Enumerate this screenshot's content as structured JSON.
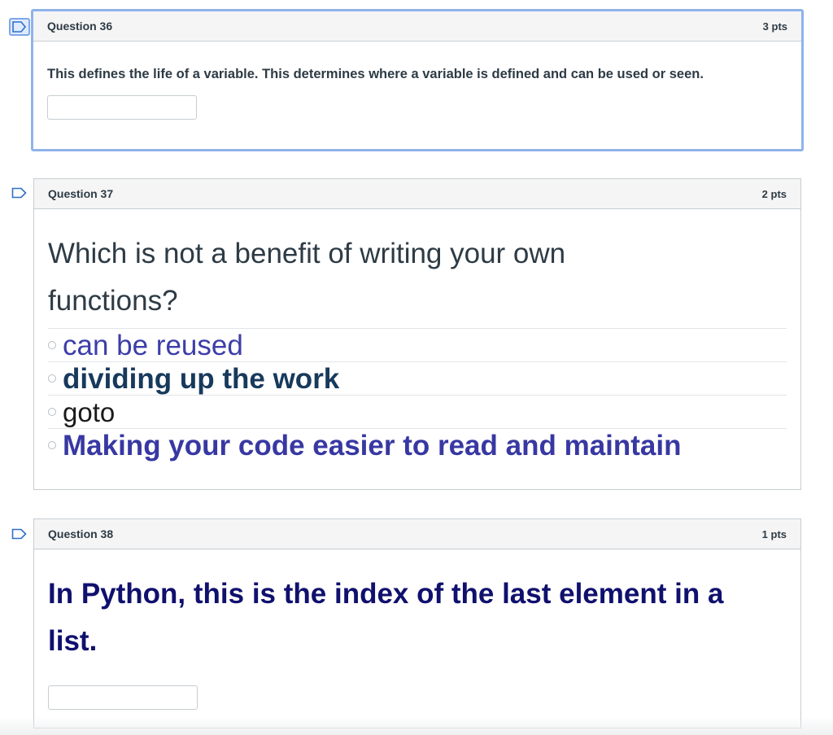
{
  "questions": [
    {
      "title": "Question 36",
      "points": "3 pts",
      "prompt": "This defines the life of a variable.  This determines where a variable is defined and can be used or seen.",
      "answer_value": ""
    },
    {
      "title": "Question 37",
      "points": "2 pts",
      "prompt": "Which is not a benefit of writing your own functions?",
      "options": [
        "can be reused",
        "dividing up the work",
        "goto",
        "Making your code easier to read and maintain"
      ]
    },
    {
      "title": "Question 38",
      "points": "1 pts",
      "prompt": "In Python, this is the index of the last element in a list.",
      "answer_value": ""
    }
  ],
  "colors": {
    "focus_border": "#8fb3ea",
    "option_1": "#3d3ea8",
    "option_2": "#17395c",
    "option_3": "#1a1a1a",
    "option_4": "#3838a3",
    "q38_prompt": "#10106e"
  },
  "icons": {
    "flag": "bookmark-flag-icon",
    "radio": "radio-button-icon"
  }
}
